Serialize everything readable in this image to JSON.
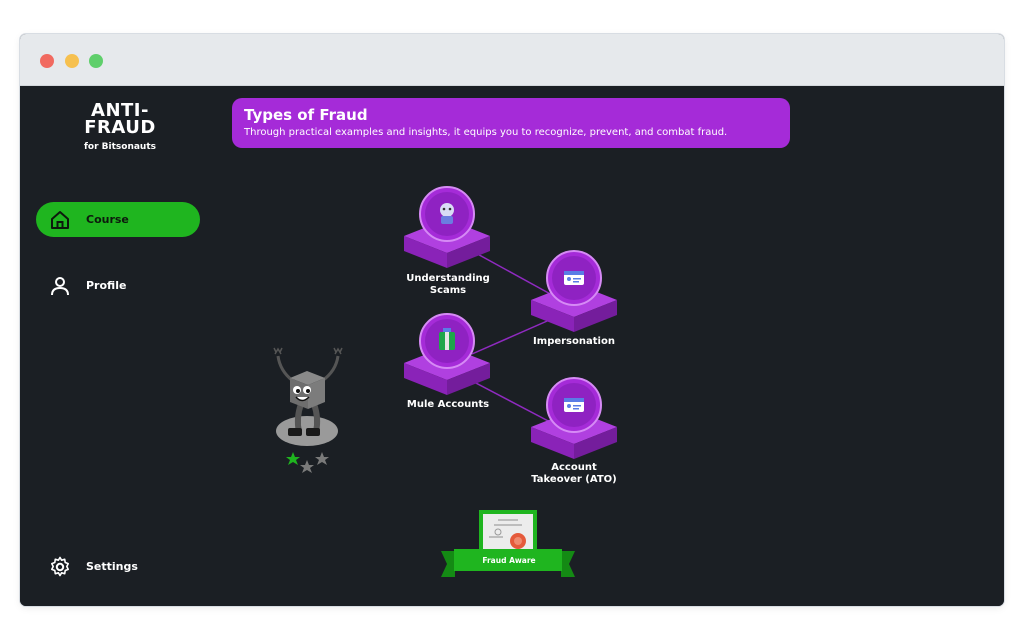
{
  "logo": {
    "title_line1": "ANTI-",
    "title_line2": "FRAUD",
    "subtitle": "for Bitsonauts"
  },
  "nav": {
    "course": "Course",
    "profile": "Profile",
    "settings": "Settings"
  },
  "banner": {
    "title": "Types of Fraud",
    "description": "Through practical examples and insights, it equips you to recognize, prevent, and combat fraud."
  },
  "lessons": [
    {
      "line1": "Understanding",
      "line2": "Scams",
      "icon": "scam-icon"
    },
    {
      "line1": "Impersonation",
      "line2": "",
      "icon": "id-card-icon"
    },
    {
      "line1": "Mule Accounts",
      "line2": "",
      "icon": "mule-icon"
    },
    {
      "line1": "Account",
      "line2": "Takeover (ATO)",
      "icon": "id-card-icon"
    }
  ],
  "badge": {
    "label": "Fraud Aware"
  },
  "mascot": {
    "stars_earned": 1,
    "stars_total": 3
  },
  "colors": {
    "accent_purple": "#a52bd8",
    "accent_green": "#1fb51f",
    "background": "#1b1f24"
  }
}
